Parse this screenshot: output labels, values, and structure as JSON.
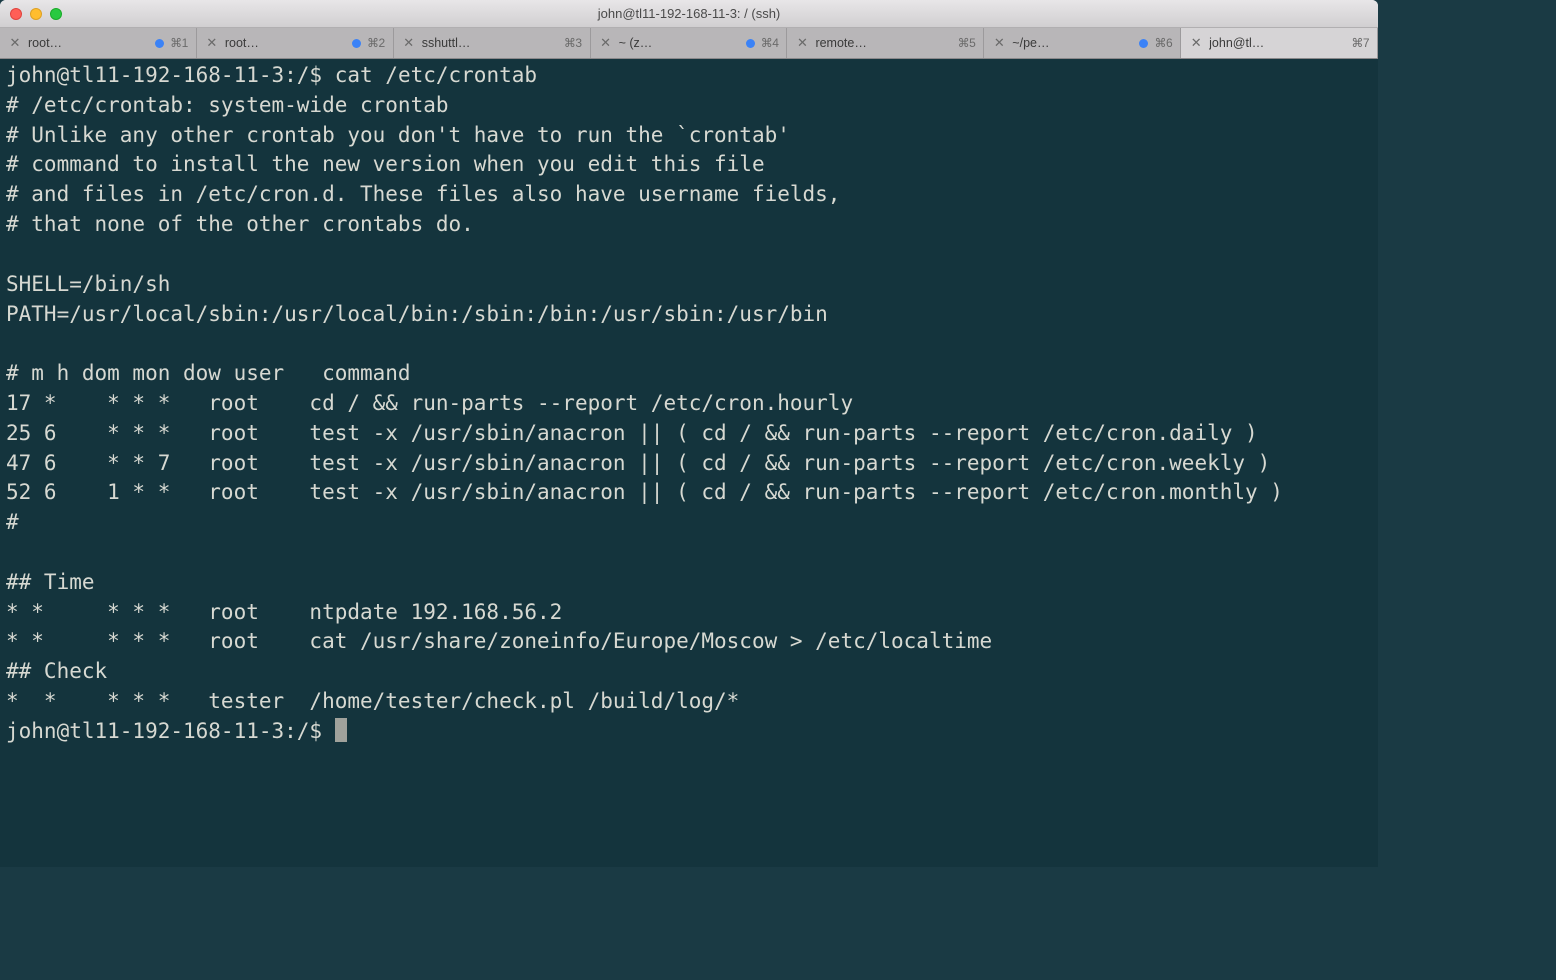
{
  "window": {
    "title": "john@tl11-192-168-11-3: / (ssh)"
  },
  "tabs": [
    {
      "label": "root…",
      "dot": true,
      "shortcut": "⌘1",
      "active": false
    },
    {
      "label": "root…",
      "dot": true,
      "shortcut": "⌘2",
      "active": false
    },
    {
      "label": "sshuttl…",
      "dot": false,
      "shortcut": "⌘3",
      "active": false
    },
    {
      "label": "~ (z…",
      "dot": true,
      "shortcut": "⌘4",
      "active": false
    },
    {
      "label": "remote…",
      "dot": false,
      "shortcut": "⌘5",
      "active": false
    },
    {
      "label": "~/pe…",
      "dot": true,
      "shortcut": "⌘6",
      "active": false
    },
    {
      "label": "john@tl…",
      "dot": false,
      "shortcut": "⌘7",
      "active": true
    }
  ],
  "terminal": {
    "prompt1": "john@tl11-192-168-11-3:/$ ",
    "command1": "cat /etc/crontab",
    "output": "# /etc/crontab: system-wide crontab\n# Unlike any other crontab you don't have to run the `crontab'\n# command to install the new version when you edit this file\n# and files in /etc/cron.d. These files also have username fields,\n# that none of the other crontabs do.\n\nSHELL=/bin/sh\nPATH=/usr/local/sbin:/usr/local/bin:/sbin:/bin:/usr/sbin:/usr/bin\n\n# m h dom mon dow user   command\n17 *    * * *   root    cd / && run-parts --report /etc/cron.hourly\n25 6    * * *   root    test -x /usr/sbin/anacron || ( cd / && run-parts --report /etc/cron.daily )\n47 6    * * 7   root    test -x /usr/sbin/anacron || ( cd / && run-parts --report /etc/cron.weekly )\n52 6    1 * *   root    test -x /usr/sbin/anacron || ( cd / && run-parts --report /etc/cron.monthly )\n#\n\n## Time\n* *     * * *   root    ntpdate 192.168.56.2\n* *     * * *   root    cat /usr/share/zoneinfo/Europe/Moscow > /etc/localtime\n## Check\n*  *    * * *   tester  /home/tester/check.pl /build/log/*",
    "prompt2": "john@tl11-192-168-11-3:/$ "
  }
}
